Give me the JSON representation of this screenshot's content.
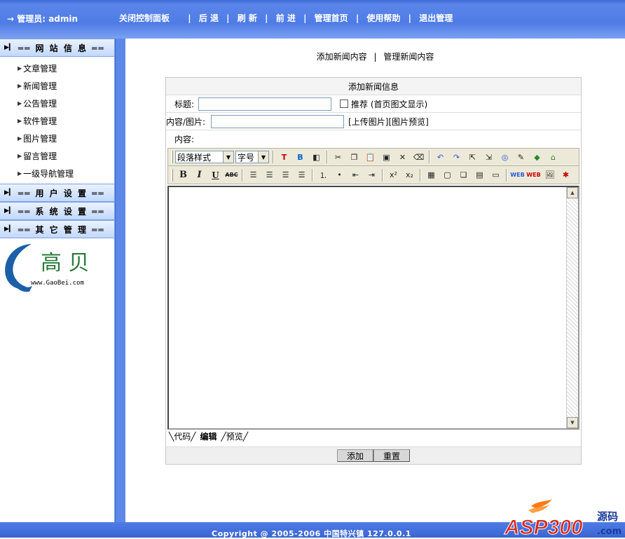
{
  "topbar": {
    "admin_label": "→ 管理员: admin",
    "nav": [
      "关闭控制面板",
      "后 退",
      "刷 新",
      "前 进",
      "管理首页",
      "使用帮助",
      "退出管理"
    ],
    "separator": "|"
  },
  "sidebar": {
    "sections": [
      {
        "title": "══ 网 站 信 息 ══",
        "items": [
          "文章管理",
          "新闻管理",
          "公告管理",
          "软件管理",
          "图片管理",
          "留言管理",
          "一级导航管理"
        ]
      },
      {
        "title": "══ 用 户 设 置 ══",
        "items": []
      },
      {
        "title": "══ 系 统 设 置 ══",
        "items": []
      },
      {
        "title": "══ 其 它 管 理 ══",
        "items": []
      }
    ],
    "logo": {
      "text": "高 贝",
      "url_text": "www.GaoBei.com",
      "color": "#1c5fa8"
    }
  },
  "main": {
    "top_links": [
      "添加新闻内容",
      "管理新闻内容"
    ],
    "form": {
      "heading": "添加新闻信息",
      "title_label": "标题:",
      "recommend_label": "推荐 (首页图文显示)",
      "content_image_label": "内容/图片:",
      "upload_link": "[上传图片]",
      "preview_link": "[图片预览]",
      "content_label": "内容:",
      "editor": {
        "style_select": "段落样式",
        "size_select": "字号",
        "mode_tabs": [
          "代码",
          "编辑",
          "预览"
        ],
        "active_mode": "编辑"
      },
      "submit_label": "添加",
      "reset_label": "重置"
    }
  },
  "footer": {
    "text": "Copyright @ 2005-2006 中国特兴镇  127.0.0.1"
  },
  "watermark": {
    "text": "ASP300",
    "suffix": "源码",
    "domain": ".com"
  },
  "colors": {
    "topbar": "#4f7be6",
    "sidebar_head": "#c3d8fb",
    "splitbar": "#5c88e8",
    "toolbar": "#ece9d8"
  }
}
